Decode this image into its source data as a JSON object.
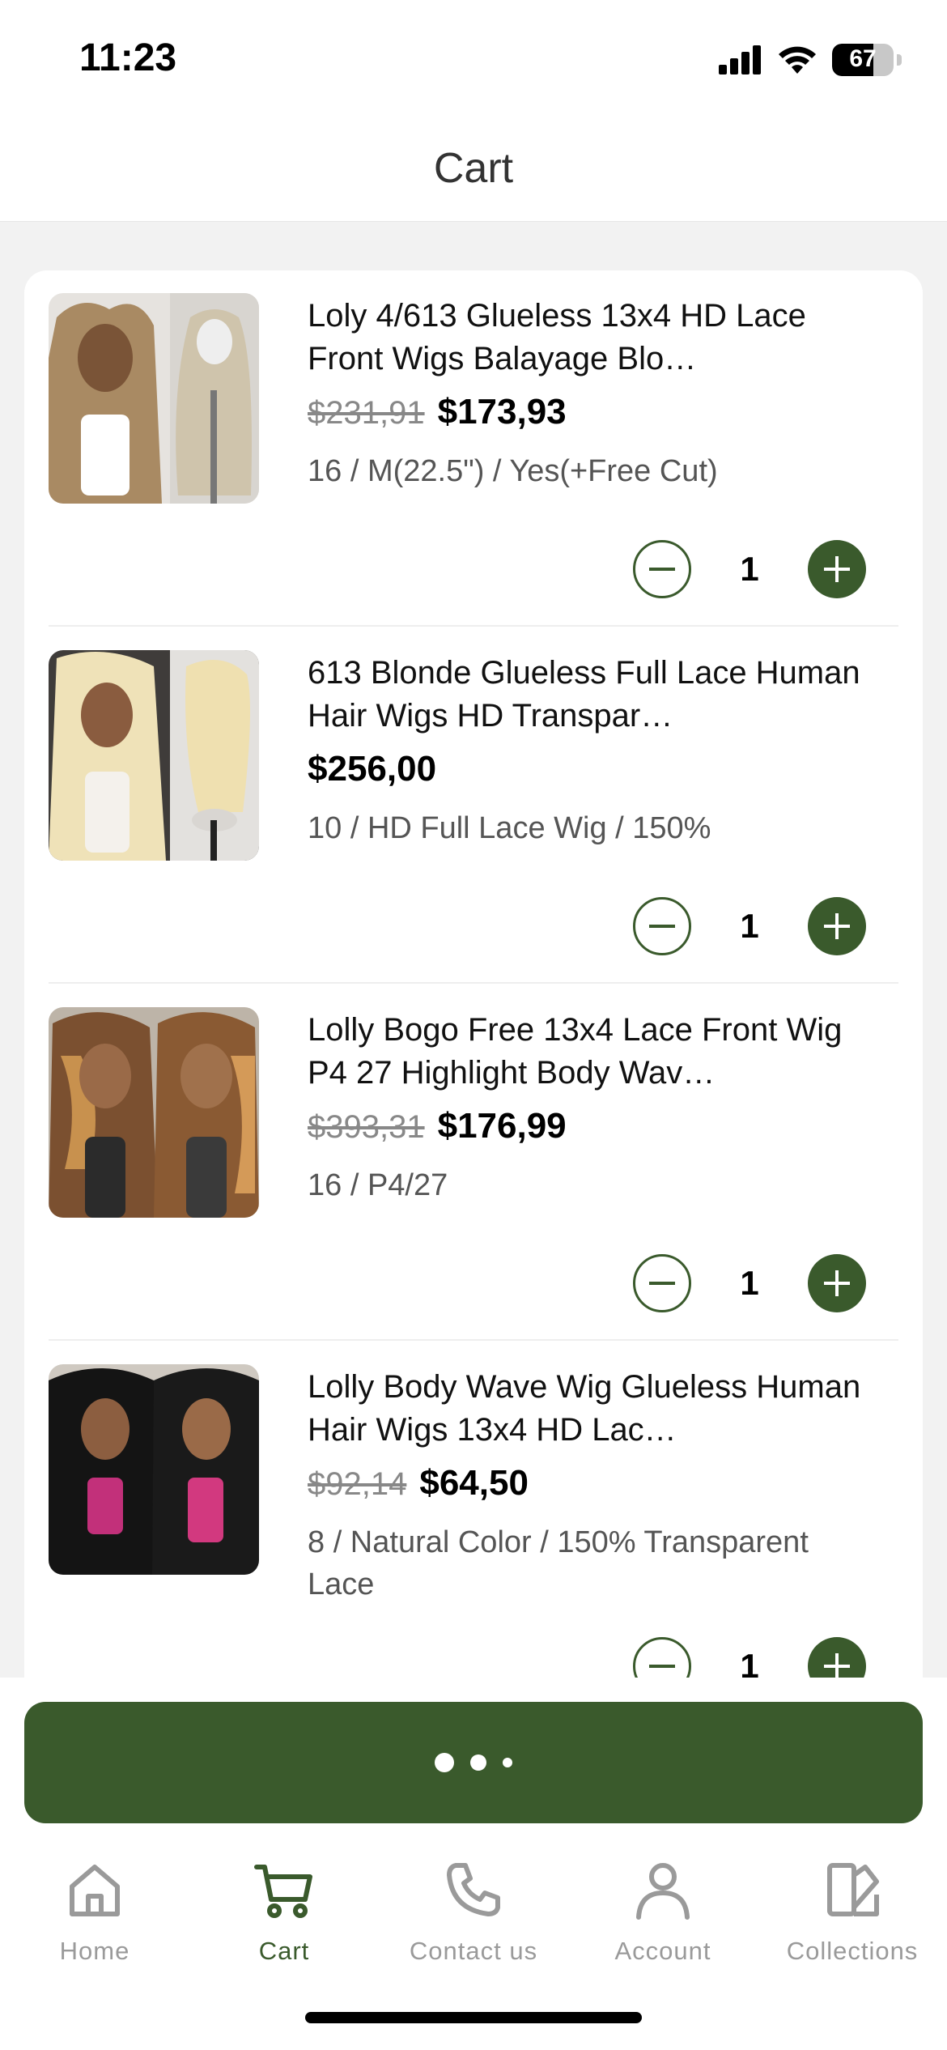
{
  "status_bar": {
    "time": "11:23",
    "battery": "67",
    "battery_level": 0.67
  },
  "header": {
    "title": "Cart"
  },
  "cart": {
    "items": [
      {
        "title": "Loly 4/613 Glueless 13x4 HD Lace Front Wigs Balayage Blo…",
        "old_price": "$231,91",
        "price": "$173,93",
        "variant": "16 / M(22.5\") / Yes(+Free Cut)",
        "quantity": "1"
      },
      {
        "title": "613 Blonde Glueless Full Lace Human Hair Wigs HD Transpar…",
        "old_price": "",
        "price": "$256,00",
        "variant": "10 / HD Full Lace Wig / 150%",
        "quantity": "1"
      },
      {
        "title": "Lolly Bogo Free 13x4 Lace Front Wig P4 27 Highlight Body Wav…",
        "old_price": "$393,31",
        "price": "$176,99",
        "variant": "16 / P4/27",
        "quantity": "1"
      },
      {
        "title": "Lolly Body Wave Wig Glueless Human Hair Wigs 13x4 HD Lac…",
        "old_price": "$92,14",
        "price": "$64,50",
        "variant": "8 / Natural Color / 150% Transparent Lace",
        "quantity": "1"
      }
    ]
  },
  "nav": {
    "tabs": [
      {
        "label": "Home",
        "icon": "home-icon",
        "active": false
      },
      {
        "label": "Cart",
        "icon": "cart-icon",
        "active": true
      },
      {
        "label": "Contact us",
        "icon": "phone-icon",
        "active": false
      },
      {
        "label": "Account",
        "icon": "person-icon",
        "active": false
      },
      {
        "label": "Collections",
        "icon": "collections-icon",
        "active": false
      }
    ]
  },
  "colors": {
    "accent": "#3a5a2c",
    "background": "#f2f2f2",
    "inactive": "#9a9a9a"
  }
}
